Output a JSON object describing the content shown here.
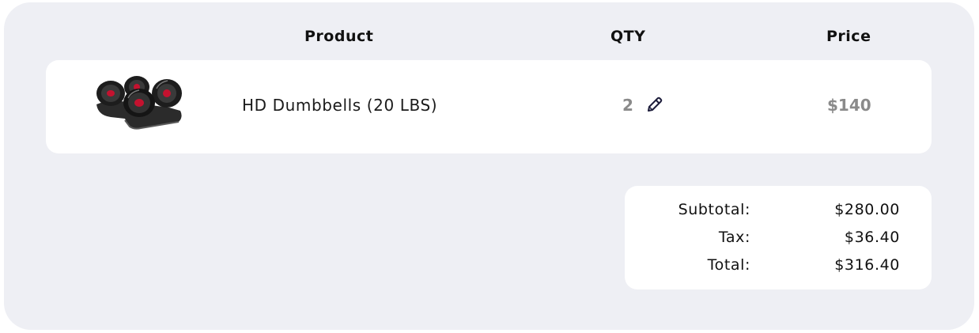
{
  "header": {
    "product": "Product",
    "qty": "QTY",
    "price": "Price"
  },
  "items": [
    {
      "image_icon": "dumbbells-image",
      "name": "HD Dumbbells (20 LBS)",
      "qty": "2",
      "edit_icon": "pencil-icon",
      "price": "$140"
    }
  ],
  "summary": {
    "subtotal_label": "Subtotal:",
    "subtotal_value": "$280.00",
    "tax_label": "Tax:",
    "tax_value": "$36.40",
    "total_label": "Total:",
    "total_value": "$316.40"
  },
  "colors": {
    "panel_background": "#eeeff4",
    "card_background": "#ffffff",
    "muted_text": "#8a8a8a",
    "accent_red": "#c4122f"
  }
}
